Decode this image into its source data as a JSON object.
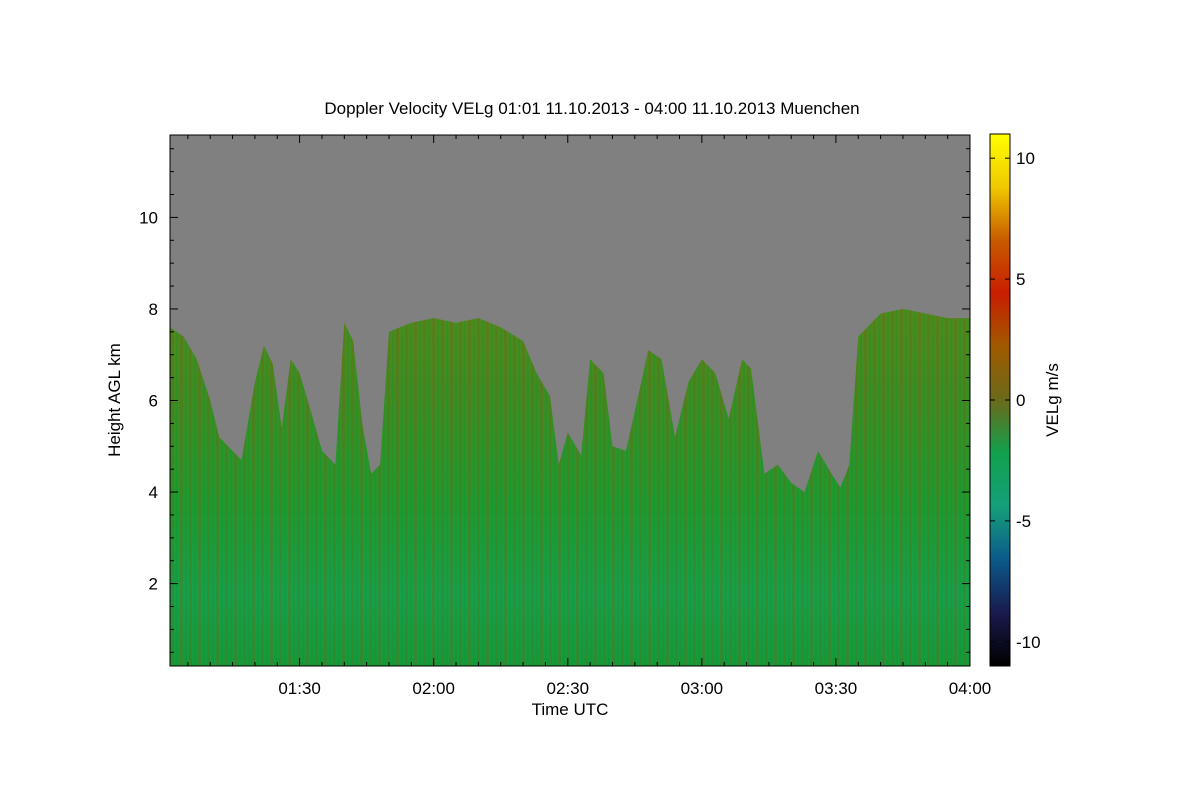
{
  "chart_data": {
    "type": "heatmap",
    "title": "Doppler Velocity VELg   01:01 11.10.2013 - 04:00 11.10.2013 Muenchen",
    "xlabel": "Time UTC",
    "ylabel": "Height AGL km",
    "x_range": [
      "01:01",
      "04:00"
    ],
    "xlim_minutes": [
      61,
      240
    ],
    "ylim": [
      0.2,
      11.8
    ],
    "x_ticks": [
      {
        "label": "01:30",
        "minutes": 90
      },
      {
        "label": "02:00",
        "minutes": 120
      },
      {
        "label": "02:30",
        "minutes": 150
      },
      {
        "label": "03:00",
        "minutes": 180
      },
      {
        "label": "03:30",
        "minutes": 210
      },
      {
        "label": "04:00",
        "minutes": 240
      }
    ],
    "y_ticks": [
      2,
      4,
      6,
      8,
      10
    ],
    "colorbar": {
      "label": "VELg m/s",
      "min": -11,
      "max": 11,
      "ticks": [
        {
          "value": 10,
          "label": "10"
        },
        {
          "value": 5,
          "label": "5"
        },
        {
          "value": 0,
          "label": "0"
        },
        {
          "value": -5,
          "label": "-5"
        },
        {
          "value": -10,
          "label": "-10"
        }
      ],
      "colors": [
        "#000000",
        "#1a1a4d",
        "#0a5a8a",
        "#15a07a",
        "#11a14e",
        "#6a6a1a",
        "#a05a00",
        "#c81e00",
        "#c85a00",
        "#f0c800",
        "#ffff00"
      ]
    },
    "background_color": "#808080",
    "cloud_top_profile": [
      {
        "t": 61,
        "h": 7.6
      },
      {
        "t": 64,
        "h": 7.4
      },
      {
        "t": 67,
        "h": 6.9
      },
      {
        "t": 70,
        "h": 6.0
      },
      {
        "t": 72,
        "h": 5.2
      },
      {
        "t": 74,
        "h": 5.0
      },
      {
        "t": 77,
        "h": 4.7
      },
      {
        "t": 80,
        "h": 6.4
      },
      {
        "t": 82,
        "h": 7.2
      },
      {
        "t": 84,
        "h": 6.8
      },
      {
        "t": 86,
        "h": 5.4
      },
      {
        "t": 88,
        "h": 6.9
      },
      {
        "t": 90,
        "h": 6.6
      },
      {
        "t": 93,
        "h": 5.6
      },
      {
        "t": 95,
        "h": 4.9
      },
      {
        "t": 98,
        "h": 4.6
      },
      {
        "t": 100,
        "h": 7.7
      },
      {
        "t": 102,
        "h": 7.3
      },
      {
        "t": 104,
        "h": 5.5
      },
      {
        "t": 106,
        "h": 4.4
      },
      {
        "t": 108,
        "h": 4.6
      },
      {
        "t": 110,
        "h": 7.5
      },
      {
        "t": 115,
        "h": 7.7
      },
      {
        "t": 120,
        "h": 7.8
      },
      {
        "t": 125,
        "h": 7.7
      },
      {
        "t": 130,
        "h": 7.8
      },
      {
        "t": 135,
        "h": 7.6
      },
      {
        "t": 140,
        "h": 7.3
      },
      {
        "t": 143,
        "h": 6.6
      },
      {
        "t": 146,
        "h": 6.1
      },
      {
        "t": 148,
        "h": 4.6
      },
      {
        "t": 150,
        "h": 5.3
      },
      {
        "t": 153,
        "h": 4.8
      },
      {
        "t": 155,
        "h": 6.9
      },
      {
        "t": 158,
        "h": 6.6
      },
      {
        "t": 160,
        "h": 5.0
      },
      {
        "t": 163,
        "h": 4.9
      },
      {
        "t": 166,
        "h": 6.2
      },
      {
        "t": 168,
        "h": 7.1
      },
      {
        "t": 171,
        "h": 6.9
      },
      {
        "t": 174,
        "h": 5.2
      },
      {
        "t": 177,
        "h": 6.4
      },
      {
        "t": 180,
        "h": 6.9
      },
      {
        "t": 183,
        "h": 6.6
      },
      {
        "t": 186,
        "h": 5.6
      },
      {
        "t": 189,
        "h": 6.9
      },
      {
        "t": 191,
        "h": 6.7
      },
      {
        "t": 194,
        "h": 4.4
      },
      {
        "t": 197,
        "h": 4.6
      },
      {
        "t": 200,
        "h": 4.2
      },
      {
        "t": 203,
        "h": 4.0
      },
      {
        "t": 206,
        "h": 4.9
      },
      {
        "t": 209,
        "h": 4.4
      },
      {
        "t": 211,
        "h": 4.1
      },
      {
        "t": 213,
        "h": 4.6
      },
      {
        "t": 215,
        "h": 7.4
      },
      {
        "t": 220,
        "h": 7.9
      },
      {
        "t": 225,
        "h": 8.0
      },
      {
        "t": 230,
        "h": 7.9
      },
      {
        "t": 235,
        "h": 7.8
      },
      {
        "t": 240,
        "h": 7.8
      }
    ]
  }
}
